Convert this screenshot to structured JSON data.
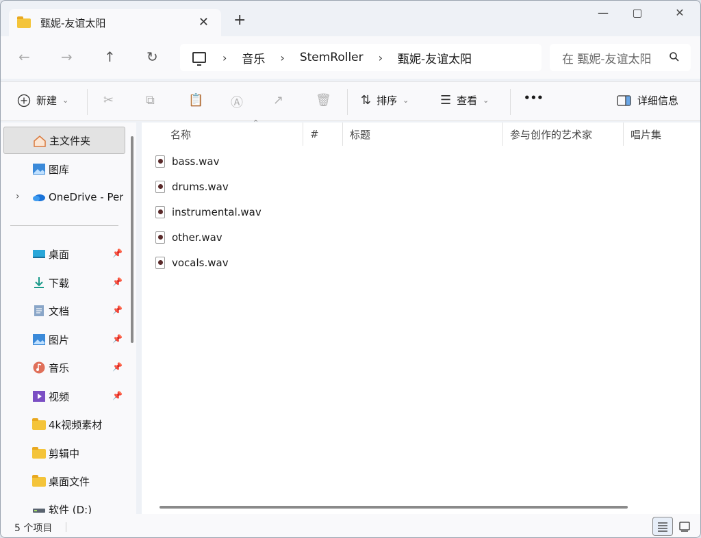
{
  "window": {
    "tab_title": "甄妮-友谊太阳",
    "close_tab": "✕",
    "new_tab": "+",
    "controls": [
      "—",
      "▢",
      "✕"
    ]
  },
  "address": {
    "breadcrumbs": [
      "音乐",
      "StemRoller",
      "甄妮-友谊太阳"
    ],
    "search_placeholder": "在 甄妮-友谊太阳"
  },
  "toolbar": {
    "new_label": "新建",
    "sort_label": "排序",
    "view_label": "查看",
    "more_label": "•••",
    "details_label": "详细信息"
  },
  "sidebar": {
    "items": [
      {
        "label": "主文件夹",
        "icon": "home-icon"
      },
      {
        "label": "图库",
        "icon": "gallery-icon"
      },
      {
        "label": "OneDrive - Per",
        "icon": "onedrive-icon"
      },
      {
        "label": "桌面",
        "icon": "desktop-icon",
        "pinned": true
      },
      {
        "label": "下载",
        "icon": "download-icon",
        "pinned": true
      },
      {
        "label": "文档",
        "icon": "documents-icon",
        "pinned": true
      },
      {
        "label": "图片",
        "icon": "pictures-icon",
        "pinned": true
      },
      {
        "label": "音乐",
        "icon": "music-icon",
        "pinned": true
      },
      {
        "label": "视频",
        "icon": "videos-icon",
        "pinned": true
      },
      {
        "label": "4k视频素材",
        "icon": "folder-icon"
      },
      {
        "label": "剪辑中",
        "icon": "folder-icon"
      },
      {
        "label": "桌面文件",
        "icon": "folder-icon"
      },
      {
        "label": "软件 (D:)",
        "icon": "drive-icon"
      }
    ]
  },
  "columns": [
    "名称",
    "#",
    "标题",
    "参与创作的艺术家",
    "唱片集"
  ],
  "files": [
    "bass.wav",
    "drums.wav",
    "instrumental.wav",
    "other.wav",
    "vocals.wav"
  ],
  "status": {
    "count_text": "5 个项目"
  },
  "colors": {
    "accent": "#0067c0",
    "folder": "#f4c43a",
    "selected": "#e3e3e3"
  }
}
